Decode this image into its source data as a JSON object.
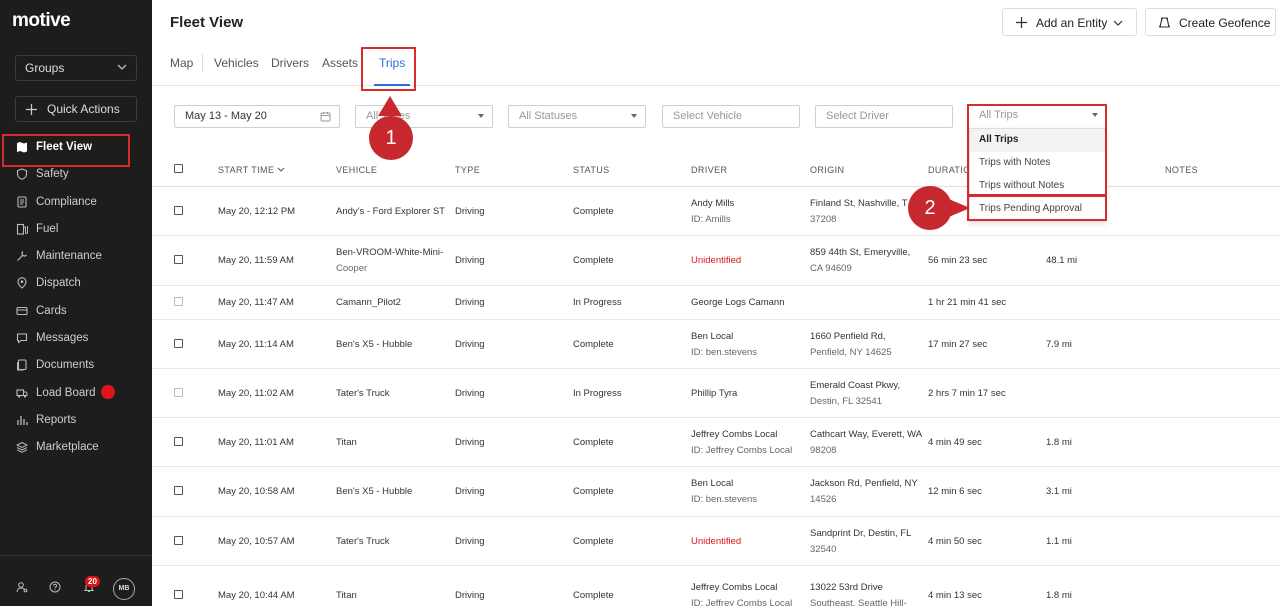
{
  "brand": "motive",
  "sidebar": {
    "groups_label": "Groups",
    "quick_actions_label": "Quick Actions",
    "items": [
      {
        "label": "Fleet View",
        "icon": "map-icon",
        "active": true
      },
      {
        "label": "Safety",
        "icon": "shield-icon"
      },
      {
        "label": "Compliance",
        "icon": "document-icon"
      },
      {
        "label": "Fuel",
        "icon": "fuel-icon"
      },
      {
        "label": "Maintenance",
        "icon": "wrench-icon"
      },
      {
        "label": "Dispatch",
        "icon": "location-icon"
      },
      {
        "label": "Cards",
        "icon": "card-icon"
      },
      {
        "label": "Messages",
        "icon": "chat-icon"
      },
      {
        "label": "Documents",
        "icon": "files-icon"
      },
      {
        "label": "Load Board",
        "icon": "truck-icon"
      },
      {
        "label": "Reports",
        "icon": "chart-icon"
      },
      {
        "label": "Marketplace",
        "icon": "stack-icon"
      }
    ],
    "notifications_count": "20",
    "avatar_initials": "MB"
  },
  "header": {
    "title": "Fleet View",
    "add_entity_label": "Add an Entity",
    "create_geofence_label": "Create Geofence"
  },
  "tabs": [
    "Map",
    "Vehicles",
    "Drivers",
    "Assets",
    "Trips"
  ],
  "active_tab": "Trips",
  "filters": {
    "date_range": "May 13 - May 20",
    "types_placeholder": "All Types",
    "statuses_placeholder": "All Statuses",
    "vehicle_placeholder": "Select Vehicle",
    "driver_placeholder": "Select Driver",
    "trips_value": "All Trips"
  },
  "trips_dropdown": {
    "options": [
      "All Trips",
      "Trips with Notes",
      "Trips without Notes",
      "Trips Pending Approval"
    ]
  },
  "callouts": [
    "1",
    "2"
  ],
  "table": {
    "columns": {
      "start_time": "START TIME",
      "vehicle": "VEHICLE",
      "type": "TYPE",
      "status": "STATUS",
      "driver": "DRIVER",
      "origin": "ORIGIN",
      "duration": "DURATIO",
      "notes": "NOTES"
    },
    "rows": [
      {
        "start": "May 20, 12:12 PM",
        "vehicle": "Andy's - Ford Explorer ST",
        "type": "Driving",
        "status": "Complete",
        "driver": "Andy Mills",
        "driver_id": "ID: Amills",
        "origin": "Finland St, Nashville, T",
        "origin2": "37208",
        "duration": "",
        "distance": ""
      },
      {
        "start": "May 20, 11:59 AM",
        "vehicle": "Ben-VROOM-White-Mini-",
        "vehicle2": "Cooper",
        "type": "Driving",
        "status": "Complete",
        "driver": "Unidentified",
        "driver_id": "",
        "origin": "859 44th St, Emeryville,",
        "origin2": "CA 94609",
        "duration": "56 min 23 sec",
        "distance": "48.1 mi"
      },
      {
        "start": "May 20, 11:47 AM",
        "vehicle": "Camann_Pilot2",
        "type": "Driving",
        "status": "In Progress",
        "driver": "George Logs Camann",
        "driver_id": "",
        "origin": "",
        "origin2": "",
        "duration": "1 hr 21 min 41 sec",
        "distance": ""
      },
      {
        "start": "May 20, 11:14 AM",
        "vehicle": "Ben's X5 - Hubble",
        "type": "Driving",
        "status": "Complete",
        "driver": "Ben Local",
        "driver_id": "ID: ben.stevens",
        "origin": "1660 Penfield Rd,",
        "origin2": "Penfield, NY 14625",
        "duration": "17 min 27 sec",
        "distance": "7.9 mi"
      },
      {
        "start": "May 20, 11:02 AM",
        "vehicle": "Tater's Truck",
        "type": "Driving",
        "status": "In Progress",
        "driver": "Phillip Tyra",
        "driver_id": "",
        "origin": "Emerald Coast Pkwy,",
        "origin2": "Destin, FL 32541",
        "duration": "2 hrs 7 min 17 sec",
        "distance": ""
      },
      {
        "start": "May 20, 11:01 AM",
        "vehicle": "Titan",
        "type": "Driving",
        "status": "Complete",
        "driver": "Jeffrey Combs Local",
        "driver_id": "ID: Jeffrey Combs Local",
        "origin": "Cathcart Way, Everett, WA",
        "origin2": "98208",
        "duration": "4 min 49 sec",
        "distance": "1.8 mi"
      },
      {
        "start": "May 20, 10:58 AM",
        "vehicle": "Ben's X5 - Hubble",
        "type": "Driving",
        "status": "Complete",
        "driver": "Ben Local",
        "driver_id": "ID: ben.stevens",
        "origin": "Jackson Rd, Penfield, NY",
        "origin2": "14526",
        "duration": "12 min 6 sec",
        "distance": "3.1 mi"
      },
      {
        "start": "May 20, 10:57 AM",
        "vehicle": "Tater's Truck",
        "type": "Driving",
        "status": "Complete",
        "driver": "Unidentified",
        "driver_id": "",
        "origin": "Sandprint Dr, Destin, FL",
        "origin2": "32540",
        "duration": "4 min 50 sec",
        "distance": "1.1 mi"
      },
      {
        "start": "May 20, 10:44 AM",
        "vehicle": "Titan",
        "type": "Driving",
        "status": "Complete",
        "driver": "Jeffrey Combs Local",
        "driver_id": "ID: Jeffrey Combs Local",
        "origin": "13022 53rd Drive",
        "origin2": "Southeast, Seattle Hill-",
        "duration": "4 min 13 sec",
        "distance": "1.8 mi"
      }
    ]
  },
  "colors": {
    "accent": "#2b6de0",
    "highlight": "#d62c30",
    "sidebar_bg": "#1d1d1d",
    "unidentified": "#e0131b"
  }
}
